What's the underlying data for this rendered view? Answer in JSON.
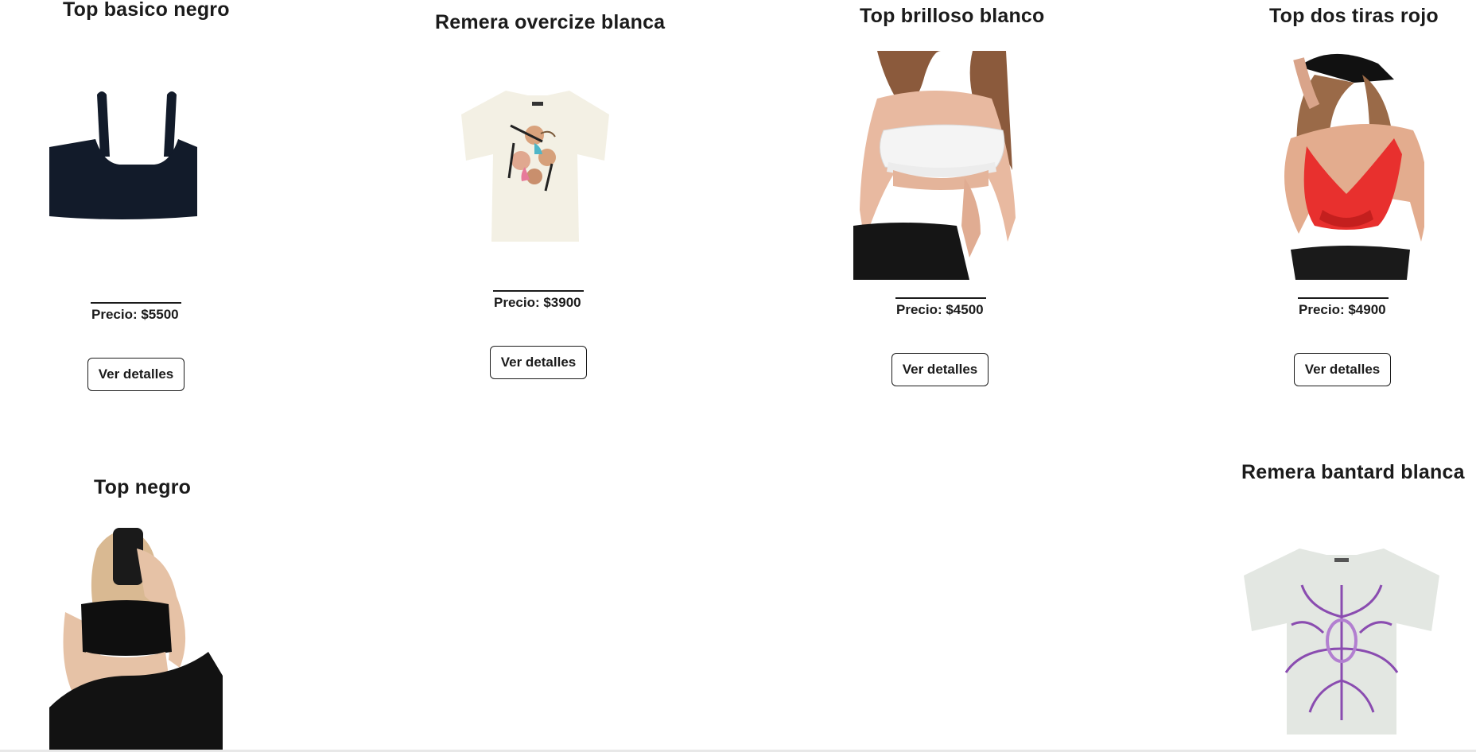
{
  "products": [
    {
      "title": "Top basico negro",
      "price": "Precio: $5500",
      "button": "Ver detalles",
      "image": "black-crop-top-image"
    },
    {
      "title": "Remera overcize blanca",
      "price": "Precio: $3900",
      "button": "Ver detalles",
      "image": "cherub-print-tshirt-image"
    },
    {
      "title": "Top brilloso blanco",
      "price": "Precio: $4500",
      "button": "Ver detalles",
      "image": "white-satin-top-model-image"
    },
    {
      "title": "Top dos tiras rojo",
      "price": "Precio: $4900",
      "button": "Ver detalles",
      "image": "red-halter-top-model-image"
    },
    {
      "title": "Top negro",
      "image": "black-top-mirror-selfie-image"
    },
    {
      "title": "Remera bantard blanca",
      "image": "purple-print-tshirt-image"
    }
  ],
  "colors": {
    "text": "#1b1b1b",
    "background": "#ffffff",
    "red_top": "#e8302e",
    "navy_top": "#121b2a"
  }
}
